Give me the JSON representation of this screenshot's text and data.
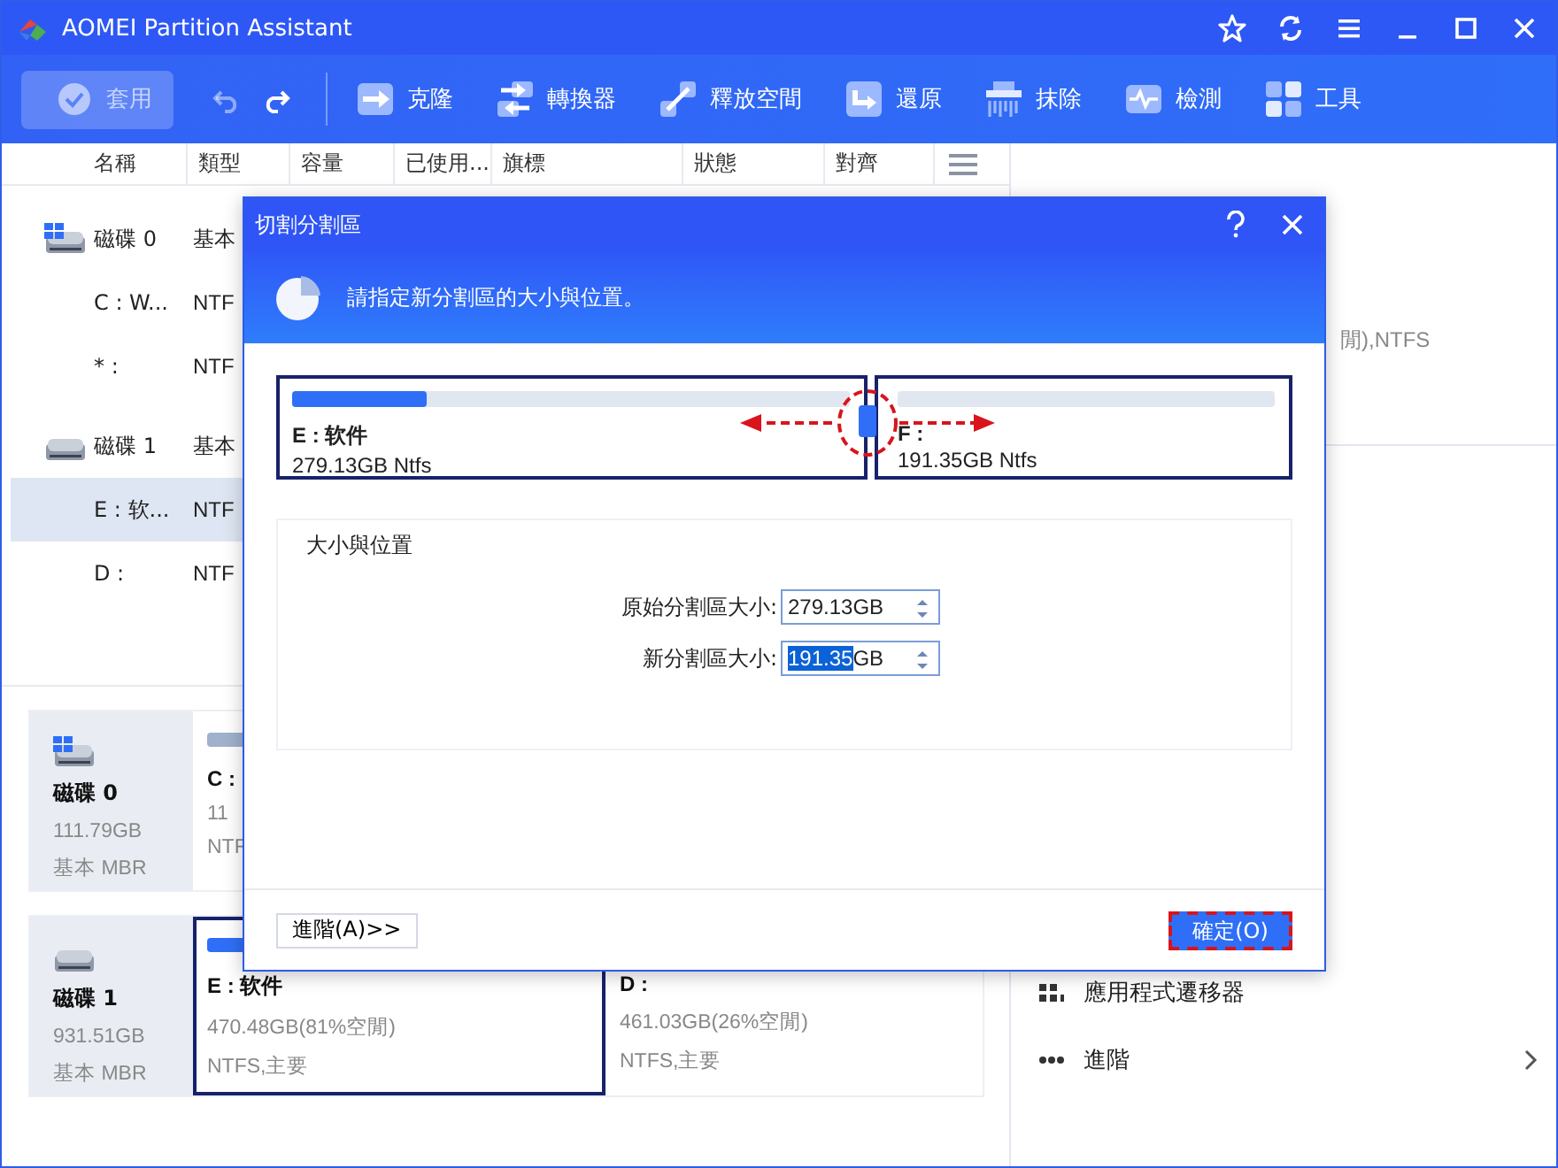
{
  "window": {
    "title": "AOMEI Partition Assistant"
  },
  "toolbar": {
    "apply": {
      "label": "套用",
      "disabled": true
    },
    "undo": {
      "disabled": true
    },
    "redo": {
      "disabled": false
    },
    "items": [
      {
        "label": "克隆",
        "kind": "clone"
      },
      {
        "label": "轉換器",
        "kind": "convert"
      },
      {
        "label": "釋放空間",
        "kind": "free"
      },
      {
        "label": "還原",
        "kind": "restore"
      },
      {
        "label": "抹除",
        "kind": "wipe"
      },
      {
        "label": "檢測",
        "kind": "test"
      },
      {
        "label": "工具",
        "kind": "tools"
      }
    ]
  },
  "table": {
    "columns": [
      "名稱",
      "類型",
      "容量",
      "已使用...",
      "旗標",
      "狀態",
      "對齊"
    ],
    "rows": [
      {
        "kind": "system-disk",
        "name": "磁碟 0",
        "type": "基本",
        "selected": false
      },
      {
        "kind": "partition",
        "name": "C : W...",
        "type": "NTF",
        "selected": false
      },
      {
        "kind": "partition",
        "name": "* :",
        "type": "NTF",
        "selected": false
      },
      {
        "kind": "disk",
        "name": "磁碟 1",
        "type": "基本",
        "selected": false
      },
      {
        "kind": "partition",
        "name": "E : 软...",
        "type": "NTF",
        "selected": true
      },
      {
        "kind": "partition",
        "name": "D :",
        "type": "NTF",
        "selected": false
      }
    ]
  },
  "disk_map": [
    {
      "kind": "system-disk",
      "name": "磁碟 0",
      "size": "111.79GB",
      "type": "基本 MBR",
      "partitions": [
        {
          "name": "C :",
          "size": "11",
          "fs": "NTF",
          "color": "#9fb1cc",
          "selected": false
        }
      ]
    },
    {
      "kind": "disk",
      "name": "磁碟 1",
      "size": "931.51GB",
      "type": "基本 MBR",
      "partitions": [
        {
          "name": "E : 软件",
          "size": "470.48GB(81%空閒)",
          "fs": "NTFS,主要",
          "color": "#2f6ff7",
          "selected": true
        },
        {
          "name": "D :",
          "size": "461.03GB(26%空閒)",
          "fs": "NTFS,主要",
          "selected": false
        }
      ]
    }
  ],
  "side_panel": {
    "info": "閒),NTFS",
    "actions": [
      {
        "label": "應用程式遷移器",
        "kind": "migrate",
        "chevron": false
      },
      {
        "label": "進階",
        "kind": "more",
        "chevron": true
      }
    ]
  },
  "dialog": {
    "title": "切割分割區",
    "instruction": "請指定新分割區的大小與位置。",
    "partitions": [
      {
        "name": "E : 软件",
        "detail": "279.13GB Ntfs",
        "level": 0.24
      },
      {
        "name": "F :",
        "detail": "191.35GB Ntfs"
      }
    ],
    "handle": {
      "highlighted": true
    },
    "group_title": "大小與位置",
    "fields": [
      {
        "label": "原始分割區大小:",
        "value": "279.13GB",
        "text_selected": false
      },
      {
        "label": "新分割區大小:",
        "value": "191.35GB",
        "text_selected": true
      }
    ],
    "advanced_button": "進階(A)>>",
    "ok_button": {
      "label": "確定(O)",
      "highlighted": true
    }
  }
}
